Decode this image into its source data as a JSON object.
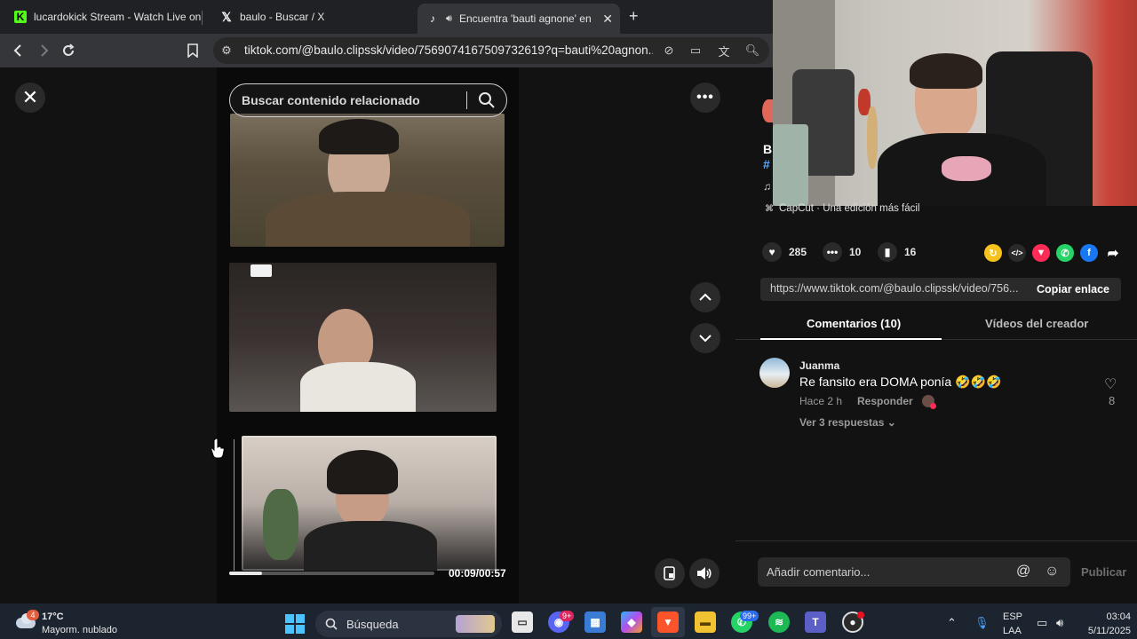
{
  "browser": {
    "tabs": [
      {
        "title": "lucardokick Stream - Watch Live on K",
        "icon": "kick-icon",
        "active": false
      },
      {
        "title": "baulo - Buscar / X",
        "icon": "x-logo-icon",
        "active": false
      },
      {
        "title": "Encuentra 'bauti agnone' en T",
        "icon": "tiktok-icon",
        "active": true
      }
    ],
    "url": "tiktok.com/@baulo.clipssk/video/7569074167509732619?q=bauti%20agnon..."
  },
  "video": {
    "search_placeholder": "Buscar contenido relacionado",
    "time": "00:09/00:57",
    "progress": 0.16
  },
  "post": {
    "caption_fragment": "B",
    "hashtag_fragment": "#",
    "music_fragment": "♫",
    "capcut_label": "CapCut · Una edición más fácil",
    "likes": "285",
    "comments": "10",
    "saves": "16",
    "link": "https://www.tiktok.com/@baulo.clipssk/video/756...",
    "copy_label": "Copiar enlace",
    "tab_comments": "Comentarios (10)",
    "tab_creator": "Vídeos del creador"
  },
  "comments": [
    {
      "user": "Juanma",
      "text": "Re fansito era DOMA ponía 🤣🤣🤣",
      "time": "Hace 2 h",
      "reply": "Responder",
      "likes": "8",
      "view_replies": "Ver 3 respuestas ⌄"
    }
  ],
  "comment_input": {
    "placeholder": "Añadir comentario...",
    "publish": "Publicar"
  },
  "taskbar": {
    "weather_temp": "17°C",
    "weather_desc": "Mayorm. nublado",
    "weather_badge": "4",
    "search": "Búsqueda",
    "discord_badge": "9+",
    "whatsapp_badge": "99+",
    "lang_top": "ESP",
    "lang_bottom": "LAA",
    "clock_time": "03:04",
    "clock_date": "5/11/2025"
  },
  "colors": {
    "accent_like": "#fe2c55",
    "tiktok_bg": "#121212",
    "taskbar_bg": "#1c2430"
  }
}
